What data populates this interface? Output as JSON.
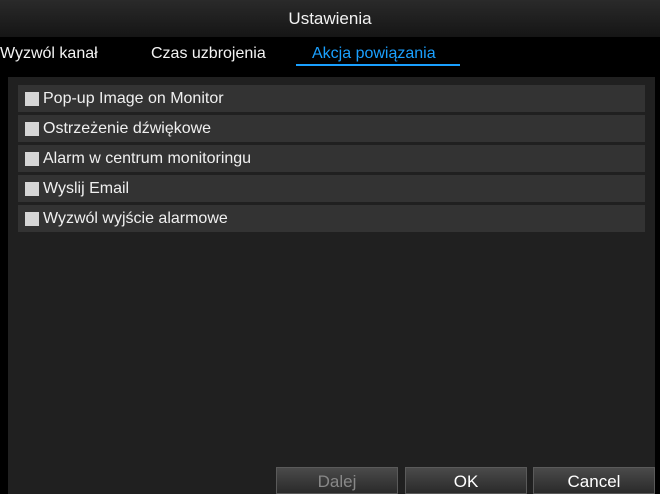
{
  "window": {
    "title": "Ustawienia"
  },
  "tabs": [
    {
      "label": "Wyzwól kanał",
      "active": false
    },
    {
      "label": "Czas uzbrojenia",
      "active": false
    },
    {
      "label": "Akcja powiązania",
      "active": true
    }
  ],
  "options": [
    {
      "label": "Pop-up Image on Monitor",
      "checked": false
    },
    {
      "label": "Ostrzeżenie dźwiękowe",
      "checked": false
    },
    {
      "label": "Alarm w centrum monitoringu",
      "checked": false
    },
    {
      "label": "Wyslij Email",
      "checked": false
    },
    {
      "label": "Wyzwól wyjście alarmowe",
      "checked": false
    }
  ],
  "buttons": {
    "next": {
      "label": "Dalej",
      "enabled": false
    },
    "ok": {
      "label": "OK",
      "enabled": true
    },
    "cancel": {
      "label": "Cancel",
      "enabled": true
    }
  },
  "colors": {
    "accent": "#1aa0ff",
    "panel": "#202020",
    "row": "#333333",
    "checkbox": "#d6d6d6"
  }
}
